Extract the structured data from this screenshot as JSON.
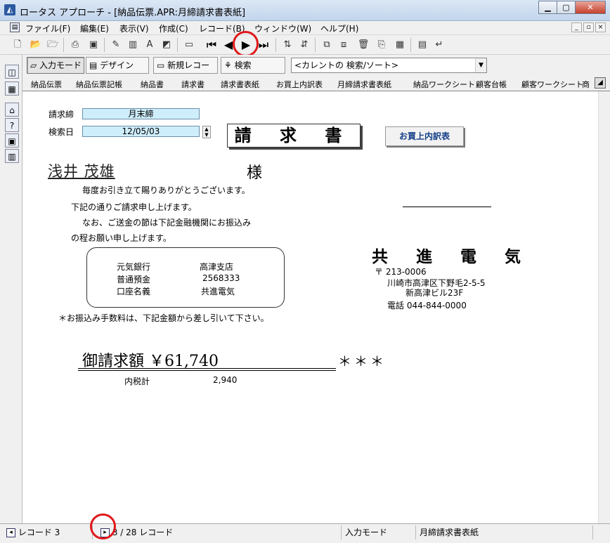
{
  "window": {
    "app_icon": "lotus-approach-icon",
    "title": "ロータス アプローチ - [納品伝票.APR:月締請求書表紙]",
    "minimize": "▁",
    "maximize": "▢",
    "close": "✕"
  },
  "menu": {
    "items": [
      "ファイル(F)",
      "編集(E)",
      "表示(V)",
      "作成(C)",
      "レコード(B)",
      "ウィンドウ(W)",
      "ヘルプ(H)"
    ],
    "mdi_buttons": [
      "_",
      "▫",
      "×"
    ]
  },
  "toolbar": {
    "nav": {
      "first": "⏮",
      "prev": "◀",
      "next": "▶",
      "last": "⏭"
    }
  },
  "modebar": {
    "browse": "入力モード",
    "design": "デザイン",
    "new_record": "新規レコード",
    "find": "検索",
    "sort_combo": "<カレントの 検索/ソート>"
  },
  "tabs": [
    "納品伝票",
    "納品伝票記帳",
    "納品書",
    "請求書",
    "請求書表紙",
    "お買上内訳表",
    "月締請求書表紙",
    "納品ワークシート",
    "顧客台帳",
    "顧客ワークシート",
    "商"
  ],
  "form": {
    "closing_label": "請求締",
    "closing_value": "月末締",
    "search_date_label": "検索日",
    "search_date_value": "12/05/03",
    "title": "請 求 書",
    "purchase_button": "お買上内訳表",
    "customer_name": "浅井 茂雄",
    "honorific": "様",
    "greeting": [
      "毎度お引き立て賜りありがとうございます。",
      "下記の通りご請求申し上げます。",
      "なお、ご送金の節は下記金融機関にお振込み",
      "の程お願い申し上げます。"
    ],
    "bank": {
      "bank_name": "元気銀行",
      "branch": "高津支店",
      "account_type": "普通預金",
      "account_no": "2568333",
      "holder_label": "口座名義",
      "holder": "共進電気"
    },
    "company": {
      "name": "共 進 電 気",
      "postal": "〒 213-0006",
      "address1": "川崎市高津区下野毛2-5-5",
      "address2": "新高津ビル23F",
      "phone": "電話 044-844-0000"
    },
    "fee_note": "＊お振込み手数料は、下記金額から差し引いて下さい。",
    "total_label": "御請求額 ￥61,740",
    "stars": "＊＊＊",
    "tax_label": "内税計",
    "tax_value": "2,940"
  },
  "status": {
    "record_label": "レコード 3",
    "record_count": "3 / 28 レコード",
    "mode": "入力モード",
    "view": "月締請求書表紙"
  }
}
